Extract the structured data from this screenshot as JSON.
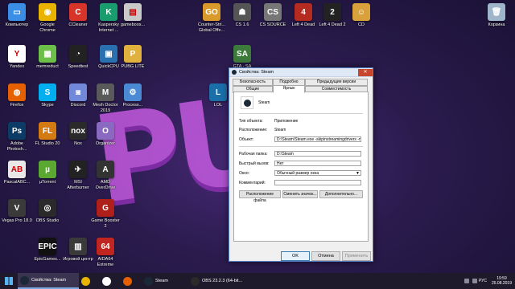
{
  "desktop": {
    "wallpaper_text": "PUB",
    "icons": [
      {
        "label": "Компьютер",
        "icon": "computer-icon",
        "color": "#3a8ee6",
        "glyph": "▭"
      },
      {
        "label": "Google Chrome",
        "icon": "chrome-icon",
        "color": "#e8b400",
        "glyph": "◉"
      },
      {
        "label": "CCleaner",
        "icon": "ccleaner-icon",
        "color": "#d7342a",
        "glyph": "C"
      },
      {
        "label": "Kaspersky Internet ...",
        "icon": "kaspersky-icon",
        "color": "#1a9d6e",
        "glyph": "K"
      },
      {
        "label": "gameboos...",
        "icon": "folder-icon",
        "color": "#c9c9c9",
        "glyph": "▤"
      },
      {
        "label": "Counter-Stri... Global Offe...",
        "icon": "csgo-icon",
        "color": "#d99a2b",
        "glyph": "GO"
      },
      {
        "label": "CS 1.6",
        "icon": "cs16-icon",
        "color": "#555555",
        "glyph": "☗"
      },
      {
        "label": "CS SOURCE",
        "icon": "cssource-icon",
        "color": "#777777",
        "glyph": "CS"
      },
      {
        "label": "Left 4 Dead",
        "icon": "l4d-icon",
        "color": "#b52b1f",
        "glyph": "4"
      },
      {
        "label": "Left 4 Dead 2",
        "icon": "l4d2-icon",
        "color": "#222222",
        "glyph": "2"
      },
      {
        "label": "CD",
        "icon": "cd-game-icon",
        "color": "#d9a13b",
        "glyph": "☺"
      },
      {
        "label": "Корзина",
        "icon": "recycle-bin-icon",
        "color": "#9fb5c9",
        "glyph": "🗑"
      },
      {
        "label": "Yandex",
        "icon": "yandex-icon",
        "color": "#ffffff",
        "glyph": "Y"
      },
      {
        "label": "memreduct",
        "icon": "memreduct-icon",
        "color": "#6cc04a",
        "glyph": "▦"
      },
      {
        "label": "Speedtest",
        "icon": "speedtest-icon",
        "color": "#222222",
        "glyph": "◔"
      },
      {
        "label": "QuickCPU",
        "icon": "quickcpu-icon",
        "color": "#2a6fb0",
        "glyph": "▣"
      },
      {
        "label": "PUBG LITE",
        "icon": "pubg-icon",
        "color": "#e0b23d",
        "glyph": "P"
      },
      {
        "label": "GTA - SA",
        "icon": "gta-icon",
        "color": "#3d7b3d",
        "glyph": "SA"
      },
      {
        "label": "Firefox",
        "icon": "firefox-icon",
        "color": "#e66000",
        "glyph": "◍"
      },
      {
        "label": "Skype",
        "icon": "skype-icon",
        "color": "#00aff0",
        "glyph": "S"
      },
      {
        "label": "Discord",
        "icon": "discord-icon",
        "color": "#7289da",
        "glyph": "◙"
      },
      {
        "label": "Mesh Doctor 2019",
        "icon": "meshdoctor-icon",
        "color": "#5a5a5a",
        "glyph": "M"
      },
      {
        "label": "Process...",
        "icon": "process-icon",
        "color": "#4a8ad4",
        "glyph": "⚙"
      },
      {
        "label": "LOL",
        "icon": "lol-icon",
        "color": "#1b6fa8",
        "glyph": "L"
      },
      {
        "label": "Adobe Photosh...",
        "icon": "photoshop-icon",
        "color": "#0c3b66",
        "glyph": "Ps"
      },
      {
        "label": "FL Studio 20",
        "icon": "flstudio-icon",
        "color": "#d47a12",
        "glyph": "FL"
      },
      {
        "label": "Nox",
        "icon": "nox-icon",
        "color": "#2a2a2a",
        "glyph": "nox"
      },
      {
        "label": "Organizer",
        "icon": "organizer-icon",
        "color": "#8a6ac0",
        "glyph": "O"
      },
      {
        "label": "PascalABC...",
        "icon": "pascalabc-icon",
        "color": "#e8e8e8",
        "glyph": "AB"
      },
      {
        "label": "µTorrent",
        "icon": "utorrent-icon",
        "color": "#5aa832",
        "glyph": "µ"
      },
      {
        "label": "MSI Afterburner",
        "icon": "msi-icon",
        "color": "#222222",
        "glyph": "✈"
      },
      {
        "label": "AMD OverDrive",
        "icon": "amd-icon",
        "color": "#333333",
        "glyph": "A"
      },
      {
        "label": "Vegas Pro 18.0",
        "icon": "vegas-icon",
        "color": "#3a3a3a",
        "glyph": "V"
      },
      {
        "label": "OBS Studio",
        "icon": "obs-icon",
        "color": "#2a2a2a",
        "glyph": "◎"
      },
      {
        "label": "Game Booster 2",
        "icon": "gamebooster-icon",
        "color": "#b0201a",
        "glyph": "G"
      },
      {
        "label": "EpicGames...",
        "icon": "epic-icon",
        "color": "#111111",
        "glyph": "EPIC"
      },
      {
        "label": "Игровой центр",
        "icon": "gamecenter-icon",
        "color": "#3a3a3a",
        "glyph": "▥"
      },
      {
        "label": "AIDA64 Extreme",
        "icon": "aida-icon",
        "color": "#c0251f",
        "glyph": "64"
      }
    ]
  },
  "dialog": {
    "title": "Свойства: Steam",
    "close_glyph": "✕",
    "tabs_row1": [
      "Безопасность",
      "Подробно",
      "Предыдущие версии"
    ],
    "tabs_row2": [
      "Общие",
      "Ярлык",
      "Совместимость"
    ],
    "app_name": "Steam",
    "fields": {
      "object_type_label": "Тип объекта:",
      "object_type_value": "Приложение",
      "location_label": "Расположение:",
      "location_value": "Steam",
      "object_label": "Объект:",
      "object_value": "D:\\Steam\\Steam.exe -skipinstreamingdrivers -nofica",
      "workdir_label": "Рабочая папка:",
      "workdir_value": "D:\\Steam",
      "hotkey_label": "Быстрый вызов:",
      "hotkey_value": "Нет",
      "window_label": "Окно:",
      "window_value": "Обычный размер окна",
      "comment_label": "Комментарий:",
      "comment_value": ""
    },
    "panel_buttons": [
      "Расположение файла",
      "Сменить значок...",
      "Дополнительно..."
    ],
    "buttons": {
      "ok": "OK",
      "cancel": "Отмена",
      "apply": "Применить"
    }
  },
  "taskbar": {
    "items": [
      {
        "label": "Свойства: Steam",
        "icon": "steam-icon",
        "color": "#1b2838",
        "active": true
      },
      {
        "label": "",
        "icon": "chrome-icon",
        "color": "#e8b400",
        "active": false
      },
      {
        "label": "",
        "icon": "yandex-icon",
        "color": "#ffffff",
        "active": false
      },
      {
        "label": "",
        "icon": "firefox-icon",
        "color": "#e66000",
        "active": false
      },
      {
        "label": "Steam",
        "icon": "steam-icon",
        "color": "#1b2838",
        "active": false
      },
      {
        "label": "OBS 23.2.3 (64-bit...",
        "icon": "obs-icon",
        "color": "#2a2a2a",
        "active": false
      }
    ],
    "lang": "РУС",
    "time": "19:59",
    "date": "25.08.2019"
  }
}
